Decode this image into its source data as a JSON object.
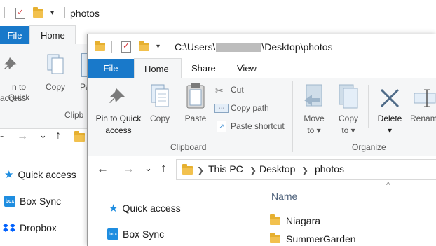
{
  "back_window": {
    "title": "photos",
    "tabs": {
      "file": "File",
      "home": "Home"
    },
    "ribbon": {
      "pin_label_line1": "n to Quick",
      "pin_label_line2": "access",
      "copy": "Copy",
      "paste_partial": "Pa",
      "clipboard_partial": "Clipb"
    },
    "nav": {
      "back": "←",
      "forward": "→",
      "recent": "⌄",
      "up": "↑"
    },
    "sidebar": [
      {
        "label": "Quick access",
        "icon": "star-icon"
      },
      {
        "label": "Box Sync",
        "icon": "box-icon"
      },
      {
        "label": "Dropbox",
        "icon": "dropbox-icon"
      }
    ]
  },
  "front_window": {
    "title_path_prefix": "C:\\Users\\",
    "title_path_suffix": "\\Desktop\\photos",
    "tabs": {
      "file": "File",
      "home": "Home",
      "share": "Share",
      "view": "View"
    },
    "ribbon": {
      "pin_line1": "Pin to Quick",
      "pin_line2": "access",
      "copy": "Copy",
      "paste": "Paste",
      "cut": "Cut",
      "copy_path": "Copy path",
      "paste_shortcut": "Paste shortcut",
      "clipboard_group": "Clipboard",
      "move_line1": "Move",
      "move_line2": "to ▾",
      "copy_to_line1": "Copy",
      "copy_to_line2": "to ▾",
      "delete_line1": "Delete",
      "delete_line2": "▾",
      "rename_partial": "Renam",
      "organize_group": "Organize"
    },
    "breadcrumb": [
      "This PC",
      "Desktop",
      "photos"
    ],
    "sidebar": [
      {
        "label": "Quick access"
      },
      {
        "label": "Box Sync"
      }
    ],
    "column_header": "Name",
    "sort_glyph": "^",
    "files": [
      {
        "name": "Niagara"
      },
      {
        "name": "SummerGarden"
      }
    ]
  },
  "colors": {
    "accent": "#1979ca",
    "folder": "#f2c14e",
    "ribbon_bg": "#f5f6f7",
    "box_blue": "#1e8de0",
    "dropbox_blue": "#0061fe"
  }
}
